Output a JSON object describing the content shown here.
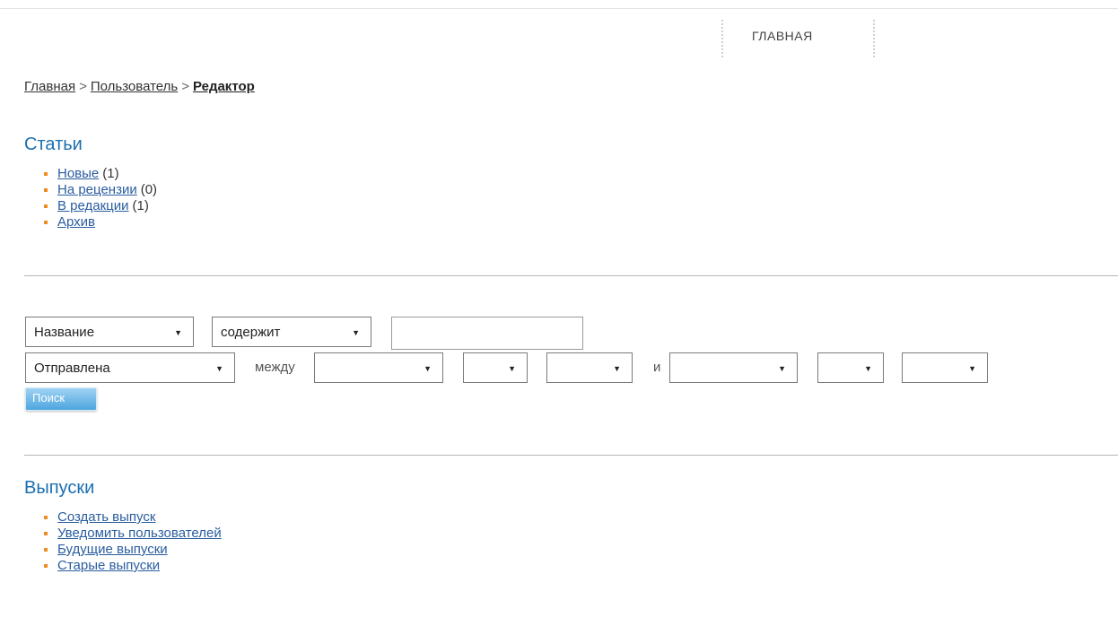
{
  "top_nav": {
    "home_label": "ГЛАВНАЯ"
  },
  "breadcrumb": {
    "home": "Главная",
    "sep1": ">",
    "user": "Пользователь",
    "sep2": ">",
    "current": "Редактор"
  },
  "articles": {
    "title": "Статьи",
    "items": [
      {
        "label": "Новые",
        "count": "(1)"
      },
      {
        "label": "На рецензии",
        "count": "(0)"
      },
      {
        "label": "В редакции",
        "count": "(1)"
      },
      {
        "label": "Архив",
        "count": ""
      }
    ]
  },
  "search": {
    "field_select": "Название",
    "operator_select": "содержит",
    "query_value": "",
    "date_field_select": "Отправлена",
    "between_label": "между",
    "and_label": "и",
    "date_from": {
      "month": "",
      "day": "",
      "year": ""
    },
    "date_to": {
      "month": "",
      "day": "",
      "year": ""
    },
    "button_label": "Поиск"
  },
  "issues": {
    "title": "Выпуски",
    "items": [
      {
        "label": "Создать выпуск"
      },
      {
        "label": "Уведомить пользователей"
      },
      {
        "label": "Будущие выпуски"
      },
      {
        "label": "Старые выпуски"
      }
    ]
  }
}
